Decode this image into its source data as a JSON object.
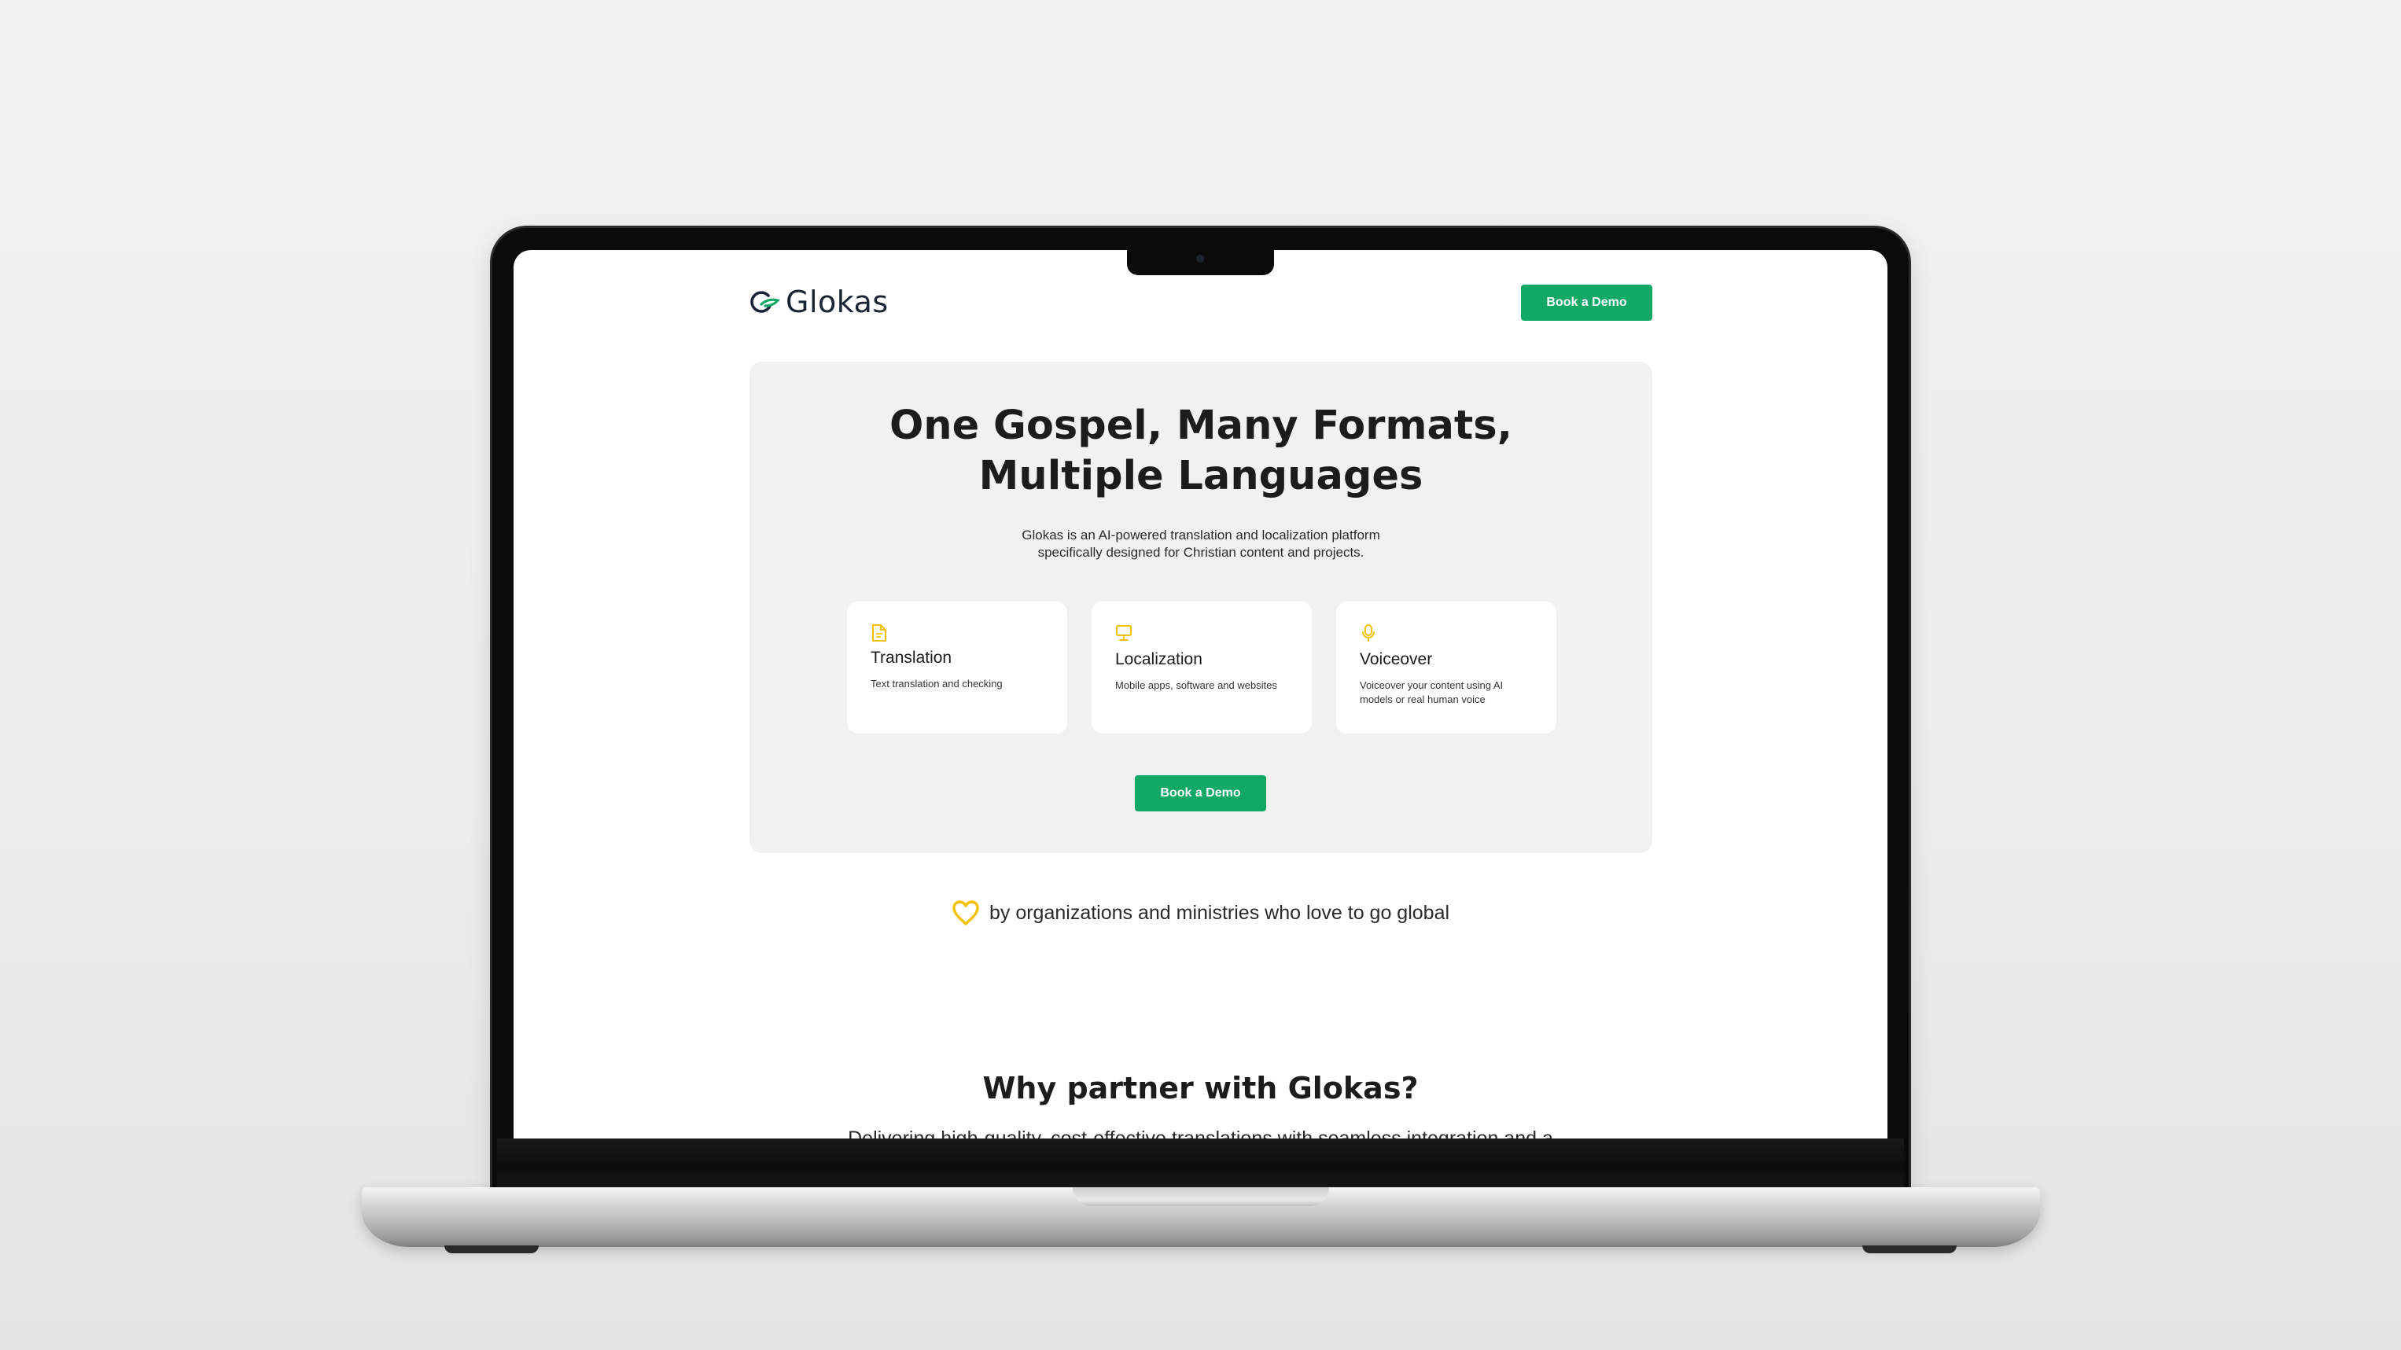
{
  "brand": {
    "name": "Glokas",
    "accent": "#12a866",
    "icon_accent": "#f2c200"
  },
  "nav": {
    "cta_label": "Book a Demo"
  },
  "hero": {
    "title_line1": "One Gospel, Many Formats,",
    "title_line2": "Multiple Languages",
    "subtitle_line1": "Glokas is an AI-powered translation and localization platform",
    "subtitle_line2": "specifically designed for Christian content and projects.",
    "cta_label": "Book a Demo",
    "cards": [
      {
        "icon": "document-icon",
        "title": "Translation",
        "desc": "Text translation and checking"
      },
      {
        "icon": "monitor-icon",
        "title": "Localization",
        "desc": "Mobile apps,  software and websites"
      },
      {
        "icon": "microphone-icon",
        "title": "Voiceover",
        "desc": "Voiceover your content using AI models or real human voice"
      }
    ]
  },
  "trust": {
    "icon": "heart-icon",
    "text": "by organizations and ministries who love to go global"
  },
  "why": {
    "title": "Why partner with Glokas?",
    "subtitle": "Delivering high-quality, cost-effective translations with seamless integration and a"
  }
}
